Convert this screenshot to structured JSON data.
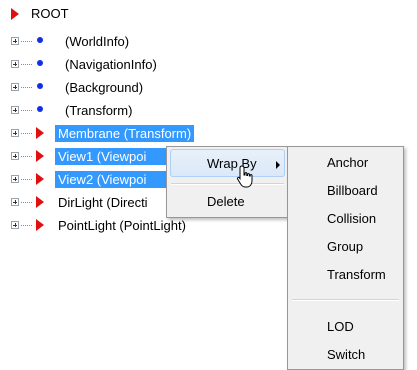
{
  "tree": {
    "root_label": "ROOT",
    "nodes": [
      {
        "label": "(WorldInfo)"
      },
      {
        "label": "(NavigationInfo)"
      },
      {
        "label": "(Background)"
      },
      {
        "label": "(Transform)"
      },
      {
        "label": "Membrane (Transform)"
      },
      {
        "label": "View1 (Viewpoi"
      },
      {
        "label": "View2 (Viewpoi"
      },
      {
        "label": "DirLight (Directi"
      },
      {
        "label": "PointLight (PointLight)"
      }
    ]
  },
  "context_menu": {
    "wrap_by": "Wrap By",
    "delete": "Delete"
  },
  "submenu": {
    "items": [
      "Anchor",
      "Billboard",
      "Collision",
      "Group",
      "Transform",
      "LOD",
      "Switch"
    ]
  },
  "colors": {
    "selection": "#3399ff",
    "node_bullet": "#1030e8",
    "node_triangle": "#e01010"
  }
}
